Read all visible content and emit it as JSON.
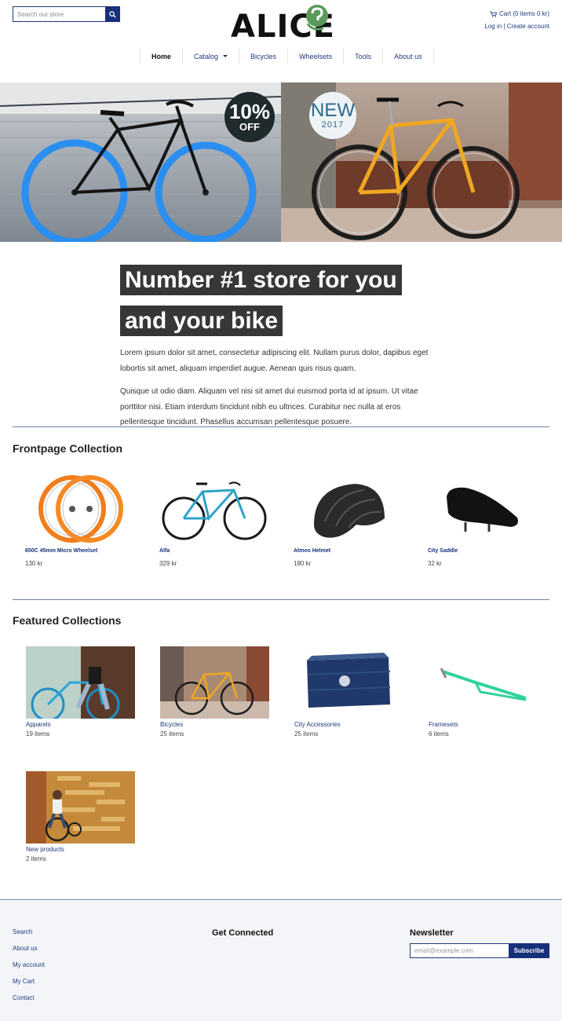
{
  "header": {
    "search_placeholder": "Search our store",
    "logo_text": "ALICE",
    "cart_label": "Cart (0 items 0 kr)",
    "login_label": "Log in",
    "separator": "|",
    "create_account_label": "Create account"
  },
  "nav": {
    "items": [
      {
        "label": "Home"
      },
      {
        "label": "Catalog"
      },
      {
        "label": "Bicycles"
      },
      {
        "label": "Wheelsets"
      },
      {
        "label": "Tools"
      },
      {
        "label": "About us"
      }
    ]
  },
  "hero": {
    "badge_left": {
      "big": "10%",
      "small": "OFF"
    },
    "badge_right": {
      "big": "NEW",
      "small": "2017"
    }
  },
  "intro": {
    "headline": "Number #1 store for you and your bike",
    "paragraph1": "Lorem ipsum dolor sit amet, consectetur adipiscing elit. Nullam purus dolor, dapibus eget lobortis sit amet, aliquam imperdiet augue. Aenean quis risus quam.",
    "paragraph2": "Quisque ut odio diam. Aliquam vel nisi sit amet dui euismod porta id at ipsum. Ut vitae porttitor nisi. Etiam interdum tincidunt nibh eu ultrices. Curabitur nec nulla at eros pellentesque tincidunt. Phasellus accumsan pellentesque posuere."
  },
  "frontpage": {
    "title": "Frontpage Collection",
    "products": [
      {
        "name": "650C 45mm Micro Wheelset",
        "price": "130 kr"
      },
      {
        "name": "Alfa",
        "price": "329 kr"
      },
      {
        "name": "Atmos Helmet",
        "price": "180 kr"
      },
      {
        "name": "City Saddle",
        "price": "32 kr"
      }
    ]
  },
  "featured": {
    "title": "Featured Collections",
    "collections": [
      {
        "name": "Apparels",
        "count": "19 items"
      },
      {
        "name": "Bicycles",
        "count": "25 items"
      },
      {
        "name": "City Accessories",
        "count": "25 items"
      },
      {
        "name": "Framesets",
        "count": "6 items"
      },
      {
        "name": "New products",
        "count": "2 items"
      }
    ]
  },
  "footer": {
    "links": [
      "Search",
      "About us",
      "My account",
      "My Cart",
      "Contact"
    ],
    "get_connected_title": "Get Connected",
    "newsletter_title": "Newsletter",
    "email_placeholder": "email@example.com",
    "subscribe_label": "Subscribe"
  },
  "colors": {
    "accent": "#16307a",
    "headline_bg": "#373737",
    "rule": "#6f7fb4",
    "footer_bg": "#f4f5f9"
  }
}
